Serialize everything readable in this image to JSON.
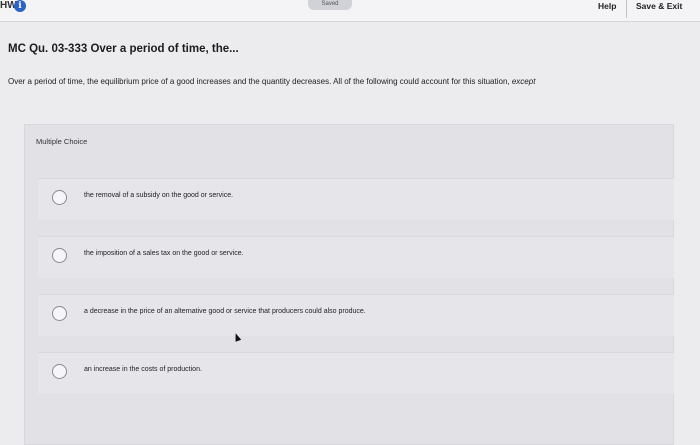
{
  "topbar": {
    "hw_label": "HW",
    "info_icon": "info-icon",
    "saved_label": "Saved",
    "help_label": "Help",
    "save_exit_label": "Save & Exit"
  },
  "question": {
    "title": "MC Qu. 03-333 Over a period of time, the...",
    "text_main": "Over a period of time, the equilibrium price of a good increases and the quantity decreases. All of the following could account for this situation, ",
    "text_emph": "except"
  },
  "answer_panel": {
    "label": "Multiple Choice",
    "options": [
      {
        "text": "the removal of a subsidy on the good or service."
      },
      {
        "text": "the imposition of a sales tax on the good or service."
      },
      {
        "text": "a decrease in the price of an alternative good or service that producers could also produce."
      },
      {
        "text": "an increase in the costs of production."
      }
    ]
  },
  "colors": {
    "accent": "#2b63c9",
    "background": "#ececef",
    "panel": "#e2e2e6"
  }
}
